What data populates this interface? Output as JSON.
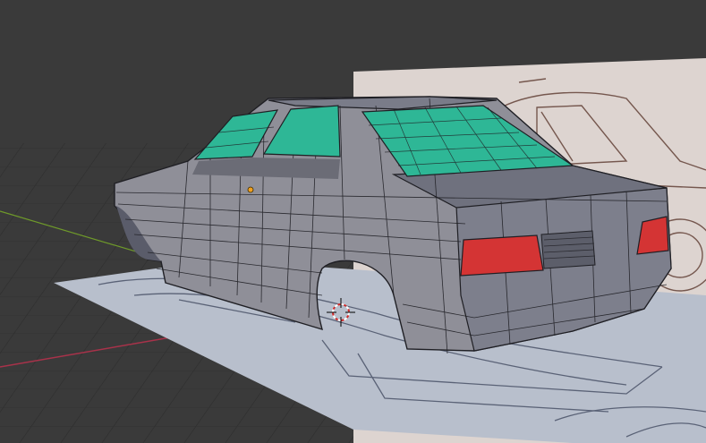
{
  "viewport": {
    "mode": "3D Viewport",
    "background_color": "#3a3a3a",
    "grid_color": "#2f2f2f",
    "axis_x_color": "#a8324a",
    "axis_y_color": "#6f9a2a"
  },
  "scene": {
    "objects": [
      {
        "name": "car-body-mesh",
        "body_color": "#8f8f98",
        "wire_color": "#1f1f24"
      },
      {
        "name": "window-glass",
        "color": "#2eb796"
      },
      {
        "name": "tail-lights",
        "color": "#d43434"
      },
      {
        "name": "blueprint-floor-plane",
        "color": "#b8bfcc"
      },
      {
        "name": "blueprint-side-plane",
        "color": "#ddd4d0"
      }
    ],
    "cursor_3d": {
      "outer": "#ffffff",
      "inner": "#d12a2a"
    },
    "origin_point_color": "#f0a020"
  }
}
